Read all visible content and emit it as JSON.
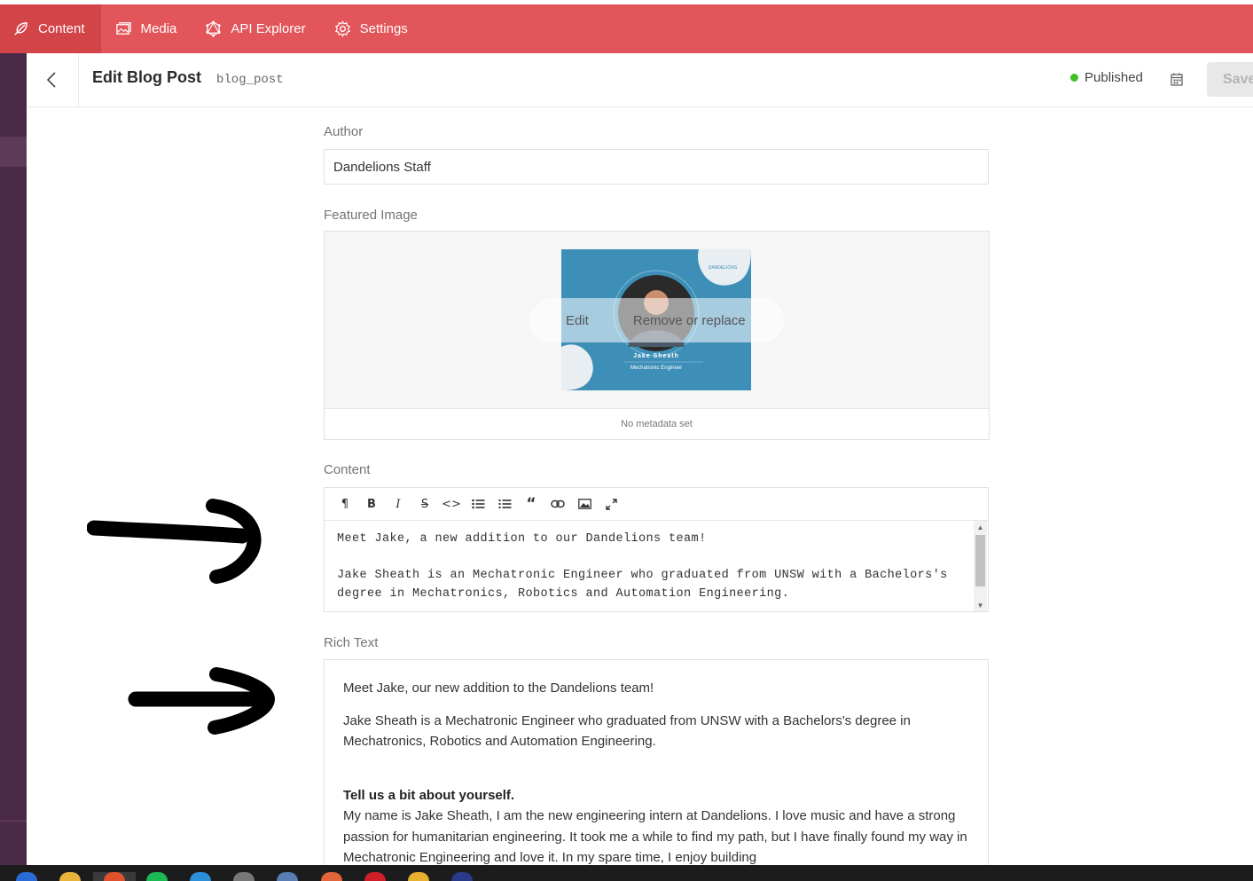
{
  "nav": {
    "items": [
      {
        "label": "Content",
        "icon": "feather-icon",
        "active": true
      },
      {
        "label": "Media",
        "icon": "image-icon",
        "active": false
      },
      {
        "label": "API Explorer",
        "icon": "graphql-icon",
        "active": false
      },
      {
        "label": "Settings",
        "icon": "gear-icon",
        "active": false
      }
    ]
  },
  "header": {
    "title": "Edit Blog Post",
    "model_key": "blog_post",
    "status": "Published",
    "status_color": "#3fbf28",
    "save_label": "Save"
  },
  "fields": {
    "author": {
      "label": "Author",
      "value": "Dandelions Staff"
    },
    "featured_image": {
      "label": "Featured Image",
      "edit_label": "Edit",
      "replace_label": "Remove or replace",
      "metadata_note": "No metadata set",
      "image_text": {
        "brand": "DANDELIONS",
        "name": "Jake Sheath",
        "role": "Mechatronic Engineer"
      }
    },
    "content": {
      "label": "Content",
      "toolbar": [
        "paragraph-icon",
        "bold-icon",
        "italic-icon",
        "strikethrough-icon",
        "code-icon",
        "bulleted-list-icon",
        "numbered-list-icon",
        "quote-icon",
        "link-icon",
        "image-icon",
        "fullscreen-icon"
      ],
      "lines": [
        "Meet Jake, a new addition to our Dandelions team!",
        "Jake Sheath is an Mechatronic Engineer who graduated from UNSW with a Bachelors's",
        "degree in Mechatronics, Robotics and Automation Engineering."
      ]
    },
    "rich_text": {
      "label": "Rich Text",
      "p1": "Meet Jake, our new addition to the Dandelions team!",
      "p2": "Jake Sheath is a Mechatronic Engineer who graduated from UNSW with a Bachelors's degree in Mechatronics, Robotics and Automation Engineering.",
      "heading": "Tell us a bit about yourself.",
      "p3": "My name is Jake Sheath, I am the new engineering intern at Dandelions. I love music and have a strong passion for humanitarian engineering. It took me a while to find my path, but I have finally found my way in Mechatronic Engineering and love it. In my spare time, I enjoy building"
    }
  },
  "colors": {
    "brand": "#e2555a",
    "brand_active": "#d34449",
    "rail": "#4b2a47"
  }
}
